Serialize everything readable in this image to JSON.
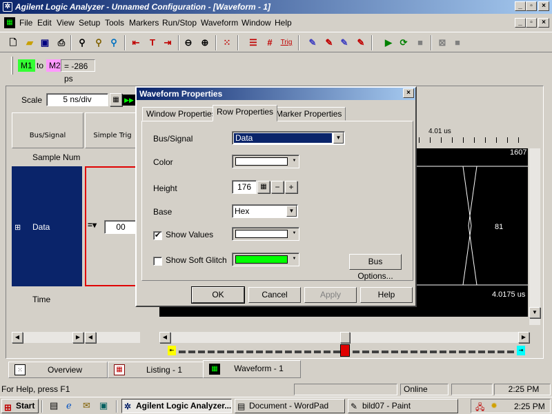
{
  "window": {
    "title": "Agilent Logic Analyzer - Unnamed Configuration - [Waveform - 1]"
  },
  "caption_buttons": {
    "minimize": "_",
    "restore": "▫",
    "close": "×"
  },
  "menu": [
    "File",
    "Edit",
    "View",
    "Setup",
    "Tools",
    "Markers",
    "Run/Stop",
    "Waveform",
    "Window",
    "Help"
  ],
  "toolbar": {
    "trig_label": "Trig"
  },
  "markers": {
    "m1": "M1",
    "to": "to",
    "m2": "M2",
    "delta": "= -286 ps"
  },
  "waveform": {
    "scale_label": "Scale",
    "scale_value": "5 ns/div",
    "col_bus_signal": "Bus/Signal",
    "col_simple_trigger": "Simple Trig",
    "sample_num": "Sample Num",
    "time_label": "Time",
    "row_name": "Data",
    "trigger_value": "00",
    "time_marker": "4.01 us",
    "top_value": "1607",
    "mid_value": "81",
    "bottom_time": "4.0175 us"
  },
  "dialog": {
    "title": "Waveform Properties",
    "tabs": [
      "Window Properties",
      "Row Properties",
      "Marker Properties"
    ],
    "active_tab": "Row Properties",
    "bus_signal_label": "Bus/Signal",
    "bus_signal_value": "Data",
    "color_label": "Color",
    "height_label": "Height",
    "height_value": "176",
    "base_label": "Base",
    "base_value": "Hex",
    "show_values_label": "Show Values",
    "show_values_checked": true,
    "show_soft_glitch_label": "Show Soft Glitch",
    "show_soft_glitch_checked": false,
    "bus_options_label": "Bus Options...",
    "ok_label": "OK",
    "cancel_label": "Cancel",
    "apply_label": "Apply",
    "help_label": "Help",
    "glitch_color": "#00ff00"
  },
  "bottom_tabs": [
    "Overview",
    "Listing - 1",
    "Waveform - 1"
  ],
  "status": {
    "help": "For Help, press F1",
    "online": "Online",
    "time": "2:25 PM"
  },
  "taskbar": {
    "start": "Start",
    "tasks": [
      "Agilent Logic Analyzer...",
      "Document - WordPad",
      "bild07 - Paint"
    ],
    "clock": "2:25 PM"
  },
  "colors": {
    "m1": "#33ff33",
    "m2": "#ff99ff",
    "navy": "#0a246a",
    "wave_bg": "#000000"
  }
}
